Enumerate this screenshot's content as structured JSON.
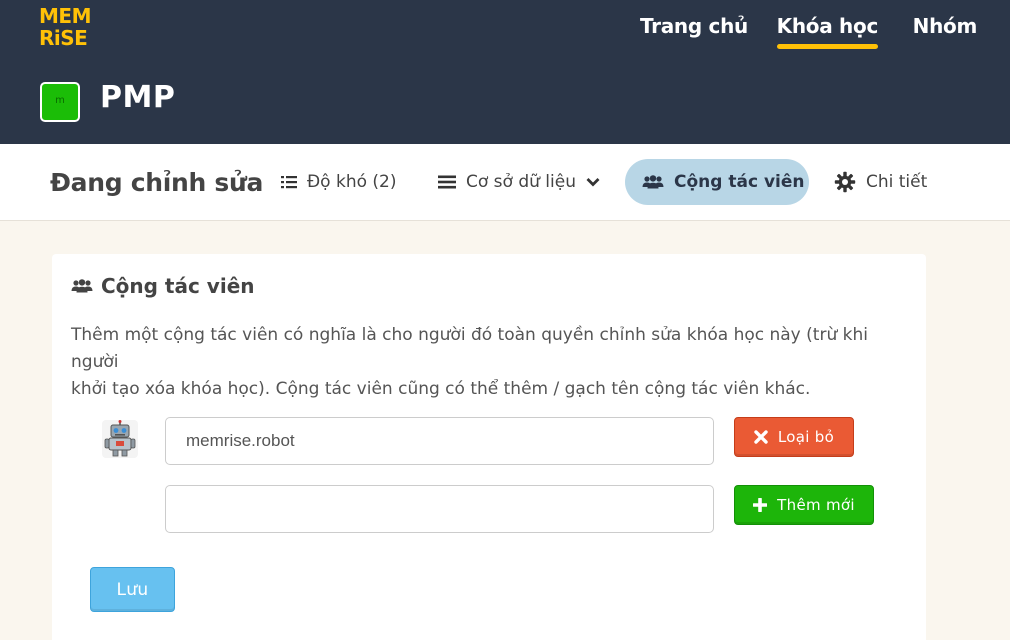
{
  "app": {
    "logo_line1": "MEM",
    "logo_line2": "RiSE",
    "brand_color": "#ffc107",
    "header_color": "#2b3648"
  },
  "topnav": {
    "items": [
      {
        "label": "Trang chủ",
        "active": false
      },
      {
        "label": "Khóa học",
        "active": true
      },
      {
        "label": "Nhóm",
        "active": false
      }
    ]
  },
  "course": {
    "badge": "m",
    "badge_color": "#1bbd07",
    "title": "PMP"
  },
  "subnav": {
    "title": "Đang chỉnh sửa",
    "tabs": [
      {
        "label": "Độ khó (2)",
        "icon": "list-icon",
        "active": false
      },
      {
        "label": "Cơ sở dữ liệu",
        "icon": "menu-icon",
        "dropdown": true,
        "active": false
      },
      {
        "label": "Cộng tác viên",
        "icon": "users-icon",
        "active": true
      },
      {
        "label": "Chi tiết",
        "icon": "gear-icon",
        "active": false
      }
    ]
  },
  "panel": {
    "title": "Cộng tác viên",
    "desc_line1": "Thêm một cộng tác viên có nghĩa là cho người đó toàn quyền chỉnh sửa khóa học này (trừ khi người",
    "desc_line2": "khởi tạo xóa khóa học). Cộng tác viên cũng có thể thêm / gạch tên cộng tác viên khác.",
    "collaborators": [
      {
        "username": "memrise.robot",
        "avatar": "robot-avatar"
      }
    ],
    "new_collaborator_value": "",
    "remove_label": "Loại bỏ",
    "add_label": "Thêm mới",
    "save_label": "Lưu",
    "remove_color": "#ea5a34",
    "add_color": "#1db50a",
    "save_color": "#67c1f0"
  }
}
